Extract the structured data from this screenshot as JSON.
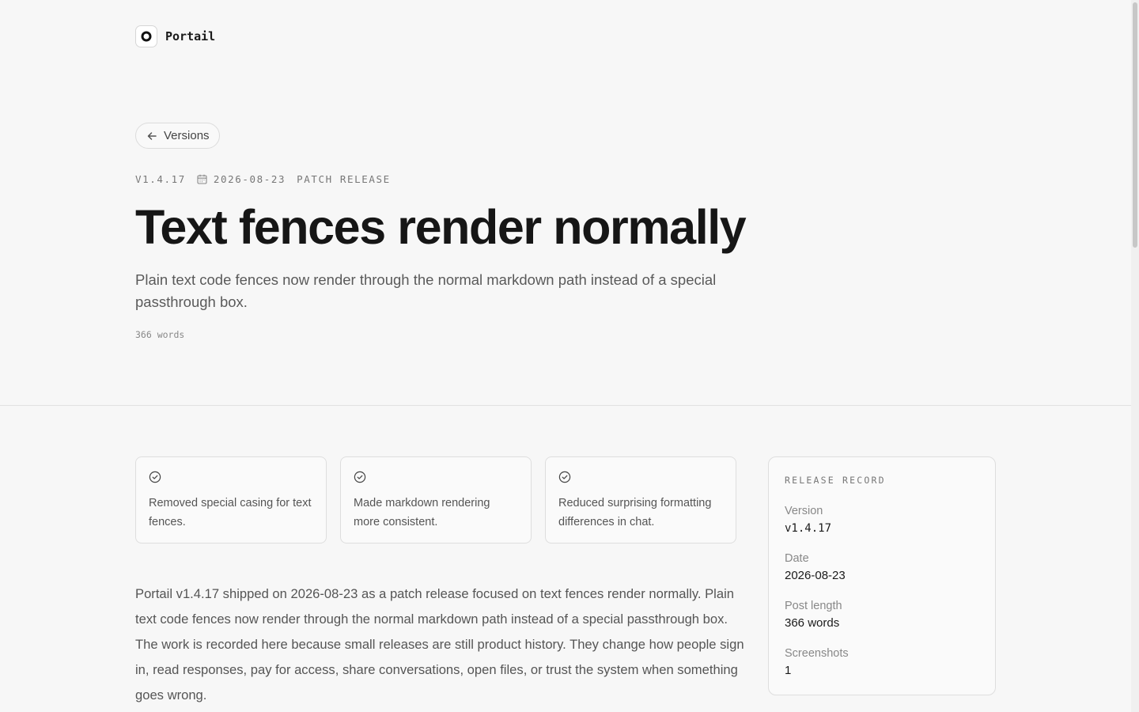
{
  "brand": {
    "name": "Portail"
  },
  "nav": {
    "back_label": "Versions"
  },
  "meta": {
    "version": "V1.4.17",
    "date": "2026-08-23",
    "type": "PATCH RELEASE"
  },
  "title": "Text fences render normally",
  "subtitle": "Plain text code fences now render through the normal markdown path instead of a special passthrough box.",
  "word_count": "366 words",
  "highlights": [
    {
      "text": "Removed special casing for text fences."
    },
    {
      "text": "Made markdown rendering more consistent."
    },
    {
      "text": "Reduced surprising formatting differences in chat."
    }
  ],
  "body": "Portail v1.4.17 shipped on 2026-08-23 as a patch release focused on text fences render normally. Plain text code fences now render through the normal markdown path instead of a special passthrough box. The work is recorded here because small releases are still product history. They change how people sign in, read responses, pay for access, share conversations, open files, or trust the system when something goes wrong.",
  "record": {
    "title": "RELEASE RECORD",
    "rows": [
      {
        "label": "Version",
        "value": "v1.4.17"
      },
      {
        "label": "Date",
        "value": "2026-08-23"
      },
      {
        "label": "Post length",
        "value": "366 words"
      },
      {
        "label": "Screenshots",
        "value": "1"
      }
    ]
  },
  "icons": {
    "logo": "portail-logo-icon",
    "back": "arrow-left-icon",
    "date": "calendar-icon",
    "highlight": "check-circle-icon"
  }
}
